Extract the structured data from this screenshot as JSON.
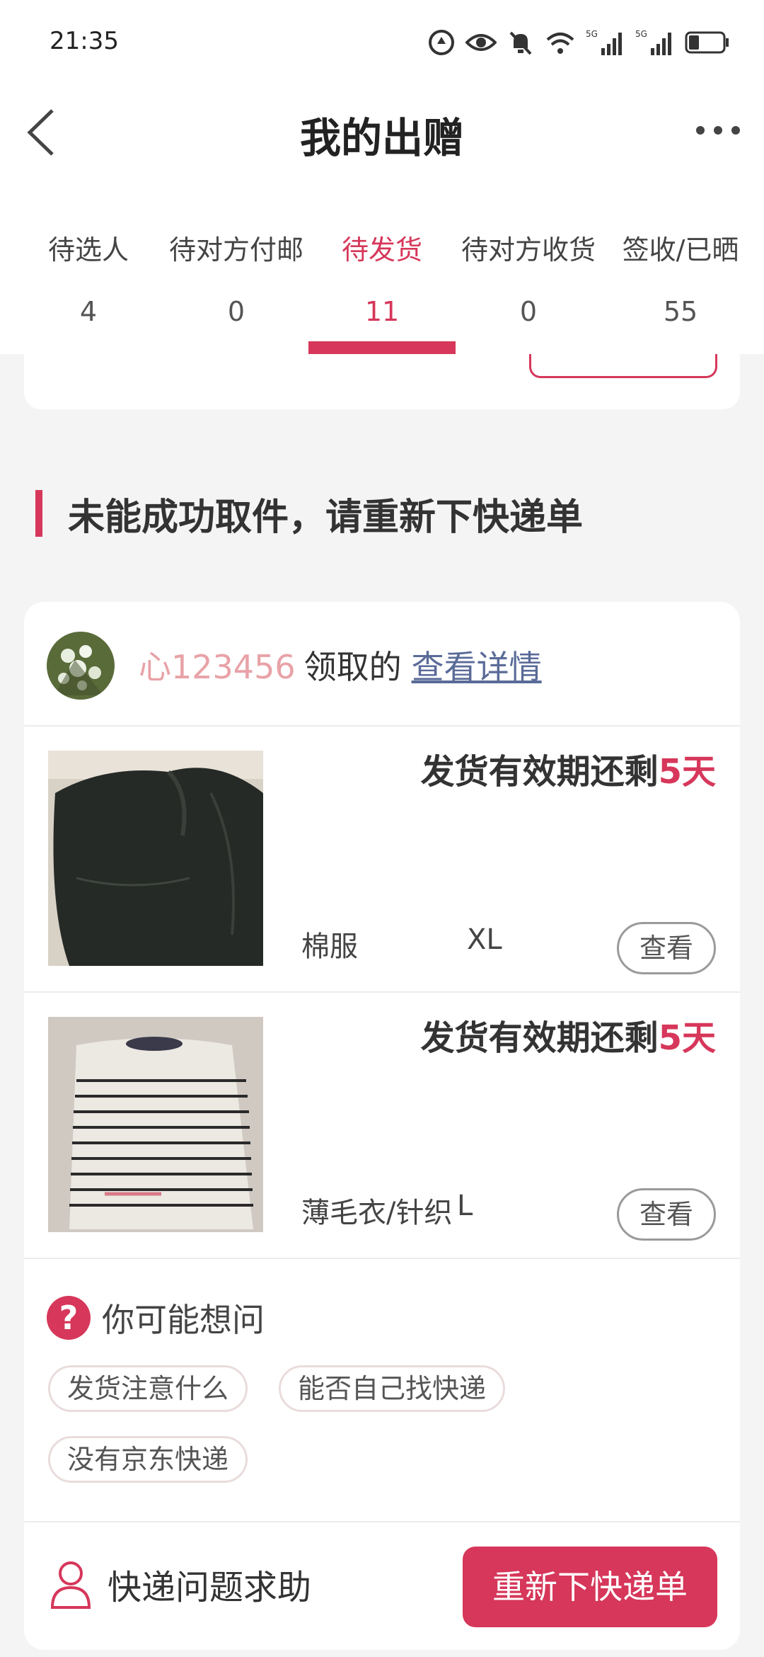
{
  "status_bar": {
    "time": "21:35",
    "icons": [
      "data-saver-icon",
      "eye-icon",
      "mute-bell-icon",
      "wifi-icon",
      "signal-5g-icon",
      "signal-5g-icon",
      "battery-icon"
    ],
    "signal_label": "5G"
  },
  "header": {
    "title": "我的出赠",
    "back_icon": "chevron-left-icon",
    "more_icon": "more-dots-icon"
  },
  "tabs": [
    {
      "label": "待选人",
      "count": "4"
    },
    {
      "label": "待对方付邮",
      "count": "0"
    },
    {
      "label": "待发货",
      "count": "11",
      "active": true
    },
    {
      "label": "待对方收货",
      "count": "0"
    },
    {
      "label": "签收/已晒",
      "count": "55"
    }
  ],
  "section": {
    "title": "未能成功取件，请重新下快递单"
  },
  "claimer": {
    "name": "心123456",
    "verb": "领取的",
    "link": "查看详情"
  },
  "items": [
    {
      "deadline_prefix": "发货有效期还剩",
      "deadline_days": "5天",
      "category": "棉服",
      "size": "XL",
      "view_label": "查看"
    },
    {
      "deadline_prefix": "发货有效期还剩",
      "deadline_days": "5天",
      "category": "薄毛衣/针织",
      "size": "L",
      "view_label": "查看"
    }
  ],
  "faq": {
    "icon": "?",
    "title": "你可能想问",
    "chips": [
      "发货注意什么",
      "能否自己找快递",
      "没有京东快递"
    ]
  },
  "bottom": {
    "help_label": "快递问题求助",
    "help_icon": "person-icon",
    "action_label": "重新下快递单"
  },
  "colors": {
    "accent": "#d6375a",
    "link": "#5a6b98",
    "name": "#e8a2a7"
  }
}
